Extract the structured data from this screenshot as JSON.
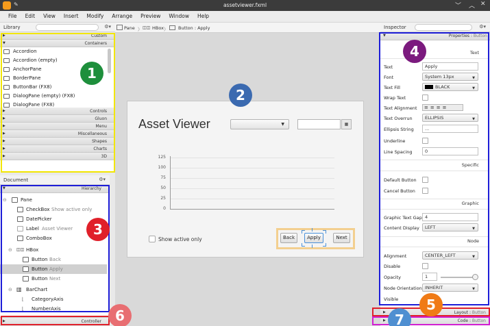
{
  "window": {
    "title": "assetviewer.fxml"
  },
  "menu": [
    "File",
    "Edit",
    "View",
    "Insert",
    "Modify",
    "Arrange",
    "Preview",
    "Window",
    "Help"
  ],
  "library": {
    "title": "Library",
    "sections_top": [
      "Custom",
      "Containers"
    ],
    "items": [
      "Accordion",
      "Accordion  (empty)",
      "AnchorPane",
      "BorderPane",
      "ButtonBar  (FX8)",
      "DialogPane (empty)  (FX8)",
      "DialogPane  (FX8)"
    ],
    "sections_bottom": [
      "Controls",
      "Gluon",
      "Menu",
      "Miscellaneous",
      "Shapes",
      "Charts",
      "3D"
    ]
  },
  "breadcrumb": [
    "Pane",
    "HBox",
    "Button : Apply"
  ],
  "stage": {
    "title": "Asset Viewer",
    "checkbox_label": "Show active only",
    "buttons": [
      "Back",
      "Apply",
      "Next"
    ],
    "y_ticks": [
      "125",
      "100",
      "75",
      "50",
      "25",
      "0"
    ]
  },
  "document": {
    "title": "Document",
    "hierarchy_label": "Hierarchy",
    "controller_label": "Controller",
    "rows": [
      {
        "name": "Pane",
        "sub": ""
      },
      {
        "name": "CheckBox",
        "sub": "Show active only"
      },
      {
        "name": "DatePicker",
        "sub": ""
      },
      {
        "name": "Label",
        "sub": "Asset Viewer"
      },
      {
        "name": "ComboBox",
        "sub": ""
      },
      {
        "name": "HBox",
        "sub": ""
      },
      {
        "name": "Button",
        "sub": "Back"
      },
      {
        "name": "Button",
        "sub": "Apply"
      },
      {
        "name": "Button",
        "sub": "Next"
      },
      {
        "name": "BarChart",
        "sub": ""
      },
      {
        "name": "CategoryAxis",
        "sub": ""
      },
      {
        "name": "NumberAxis",
        "sub": ""
      }
    ]
  },
  "inspector": {
    "title": "Inspector",
    "properties_header": "Properties",
    "properties_target": "Button",
    "groups": {
      "text": "Text",
      "specific": "Specific",
      "graphic": "Graphic",
      "node": "Node"
    },
    "text_props": {
      "text_label": "Text",
      "text_value": "Apply",
      "font_label": "Font",
      "font_value": "System 13px",
      "fill_label": "Text Fill",
      "fill_value": "BLACK",
      "wrap_label": "Wrap Text",
      "align_label": "Text Alignment",
      "overrun_label": "Text Overrun",
      "overrun_value": "ELLIPSIS",
      "ellipsis_label": "Ellipsis String",
      "ellipsis_value": "...",
      "underline_label": "Underline",
      "spacing_label": "Line Spacing",
      "spacing_value": "0"
    },
    "specific_props": {
      "default_label": "Default Button",
      "cancel_label": "Cancel Button"
    },
    "graphic_props": {
      "gap_label": "Graphic Text Gap",
      "gap_value": "4",
      "display_label": "Content Display",
      "display_value": "LEFT"
    },
    "node_props": {
      "alignment_label": "Alignment",
      "alignment_value": "CENTER_LEFT",
      "disable_label": "Disable",
      "opacity_label": "Opacity",
      "opacity_value": "1",
      "orientation_label": "Node Orientation",
      "orientation_value": "INHERIT",
      "visible_label": "Visible"
    },
    "layout_label": "Layout",
    "layout_target": "Button",
    "code_label": "Code",
    "code_target": "Button"
  },
  "badges": [
    "1",
    "2",
    "3",
    "4",
    "5",
    "6",
    "7"
  ],
  "colors": {
    "badge1": "#1e8f3c",
    "badge2": "#3b6ab0",
    "badge3": "#e0202a",
    "badge4": "#7b1a7e",
    "badge5": "#f07b16",
    "badge6": "#e86e72",
    "badge7": "#4f8fd1",
    "yellow_box": "#f2e600",
    "blue_box": "#1d1dd8",
    "red_box": "#e0202a",
    "magenta_box": "#d21fd2"
  }
}
